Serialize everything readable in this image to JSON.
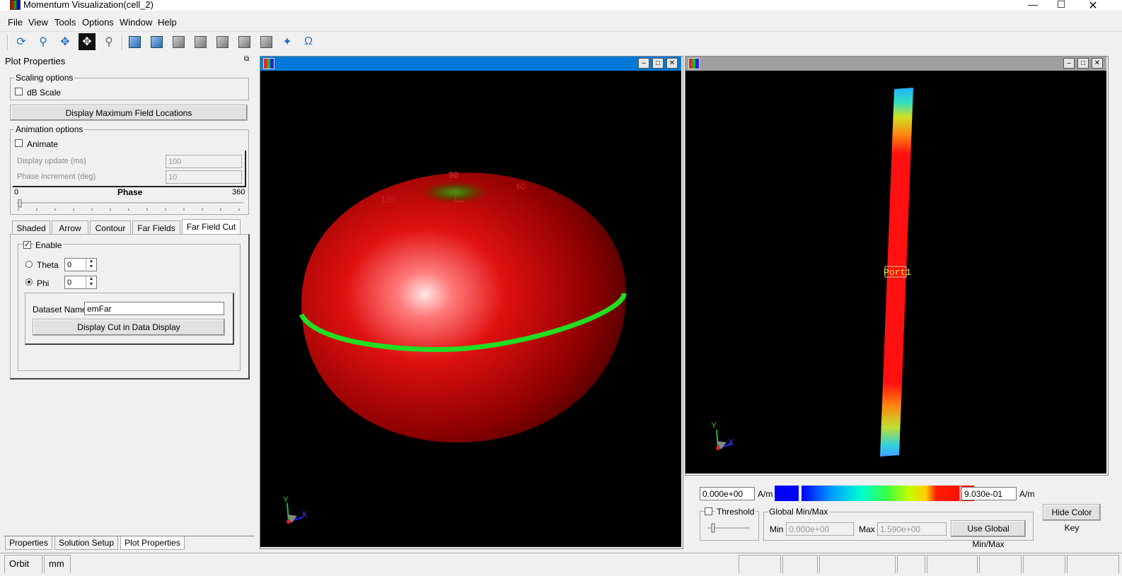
{
  "window": {
    "title": "Momentum Visualization(cell_2)"
  },
  "menu": [
    "File",
    "View",
    "Tools",
    "Options",
    "Window",
    "Help"
  ],
  "toolbar": {
    "icons": [
      "rotate-icon",
      "zoom-icon",
      "pan-icon",
      "move-icon",
      "zoom-window-icon",
      "view-top-icon",
      "view-front-icon",
      "view-back-icon",
      "view-left-icon",
      "view-right-icon",
      "view-bottom-icon",
      "view-iso-icon",
      "probe-icon",
      "omega-icon"
    ]
  },
  "plot_properties": {
    "title": "Plot Properties",
    "scaling": {
      "legend": "Scaling options",
      "db_scale_label": "dB Scale",
      "db_scale_checked": false
    },
    "max_field_button": "Display Maximum Field Locations",
    "animation": {
      "legend": "Animation options",
      "animate_label": "Animate",
      "animate_checked": false,
      "display_update_label": "Display update (ms)",
      "display_update_value": "100",
      "phase_increment_label": "Phase increment (deg)",
      "phase_increment_value": "10",
      "phase_label": "Phase",
      "phase_min": "0",
      "phase_max": "360"
    },
    "tabs": [
      "Shaded",
      "Arrow",
      "Contour",
      "Far Fields",
      "Far Field Cut"
    ],
    "selected_tab": "Far Field Cut",
    "far_field_cut": {
      "enable_label": "Enable",
      "enable_checked": true,
      "theta_label": "Theta",
      "theta_value": "0",
      "phi_label": "Phi",
      "phi_value": "0",
      "selected_angle": "Phi",
      "dataset_label": "Dataset Name",
      "dataset_value": "emFar",
      "display_cut_button": "Display Cut in Data Display"
    }
  },
  "bottom_tabs": [
    "Properties",
    "Solution Setup",
    "Plot Properties"
  ],
  "viewport_left": {
    "labels": {
      "top": "90",
      "right": "60",
      "left": "120"
    },
    "axis": {
      "y": "Y",
      "x": "X"
    }
  },
  "viewport_right": {
    "port_label": "Port1",
    "axis": {
      "y": "Y",
      "x": "X"
    }
  },
  "color_key": {
    "min_value": "0.000e+00",
    "min_unit": "A/m",
    "max_value": "9.030e-01",
    "max_unit": "A/m",
    "hide_button": "Hide Color Key",
    "threshold_label": "Threshold",
    "threshold_checked": false,
    "global": {
      "legend": "Global Min/Max",
      "min_label": "Min",
      "min_value": "0.000e+00",
      "max_label": "Max",
      "max_value": "1.590e+00",
      "use_button": "Use Global Min/Max"
    }
  },
  "statusbar": {
    "mode": "Orbit",
    "units": "mm"
  },
  "colors": {
    "accent": "#0078d7",
    "inactive_bar": "#a0a0a0",
    "trace": "#22dd22"
  }
}
